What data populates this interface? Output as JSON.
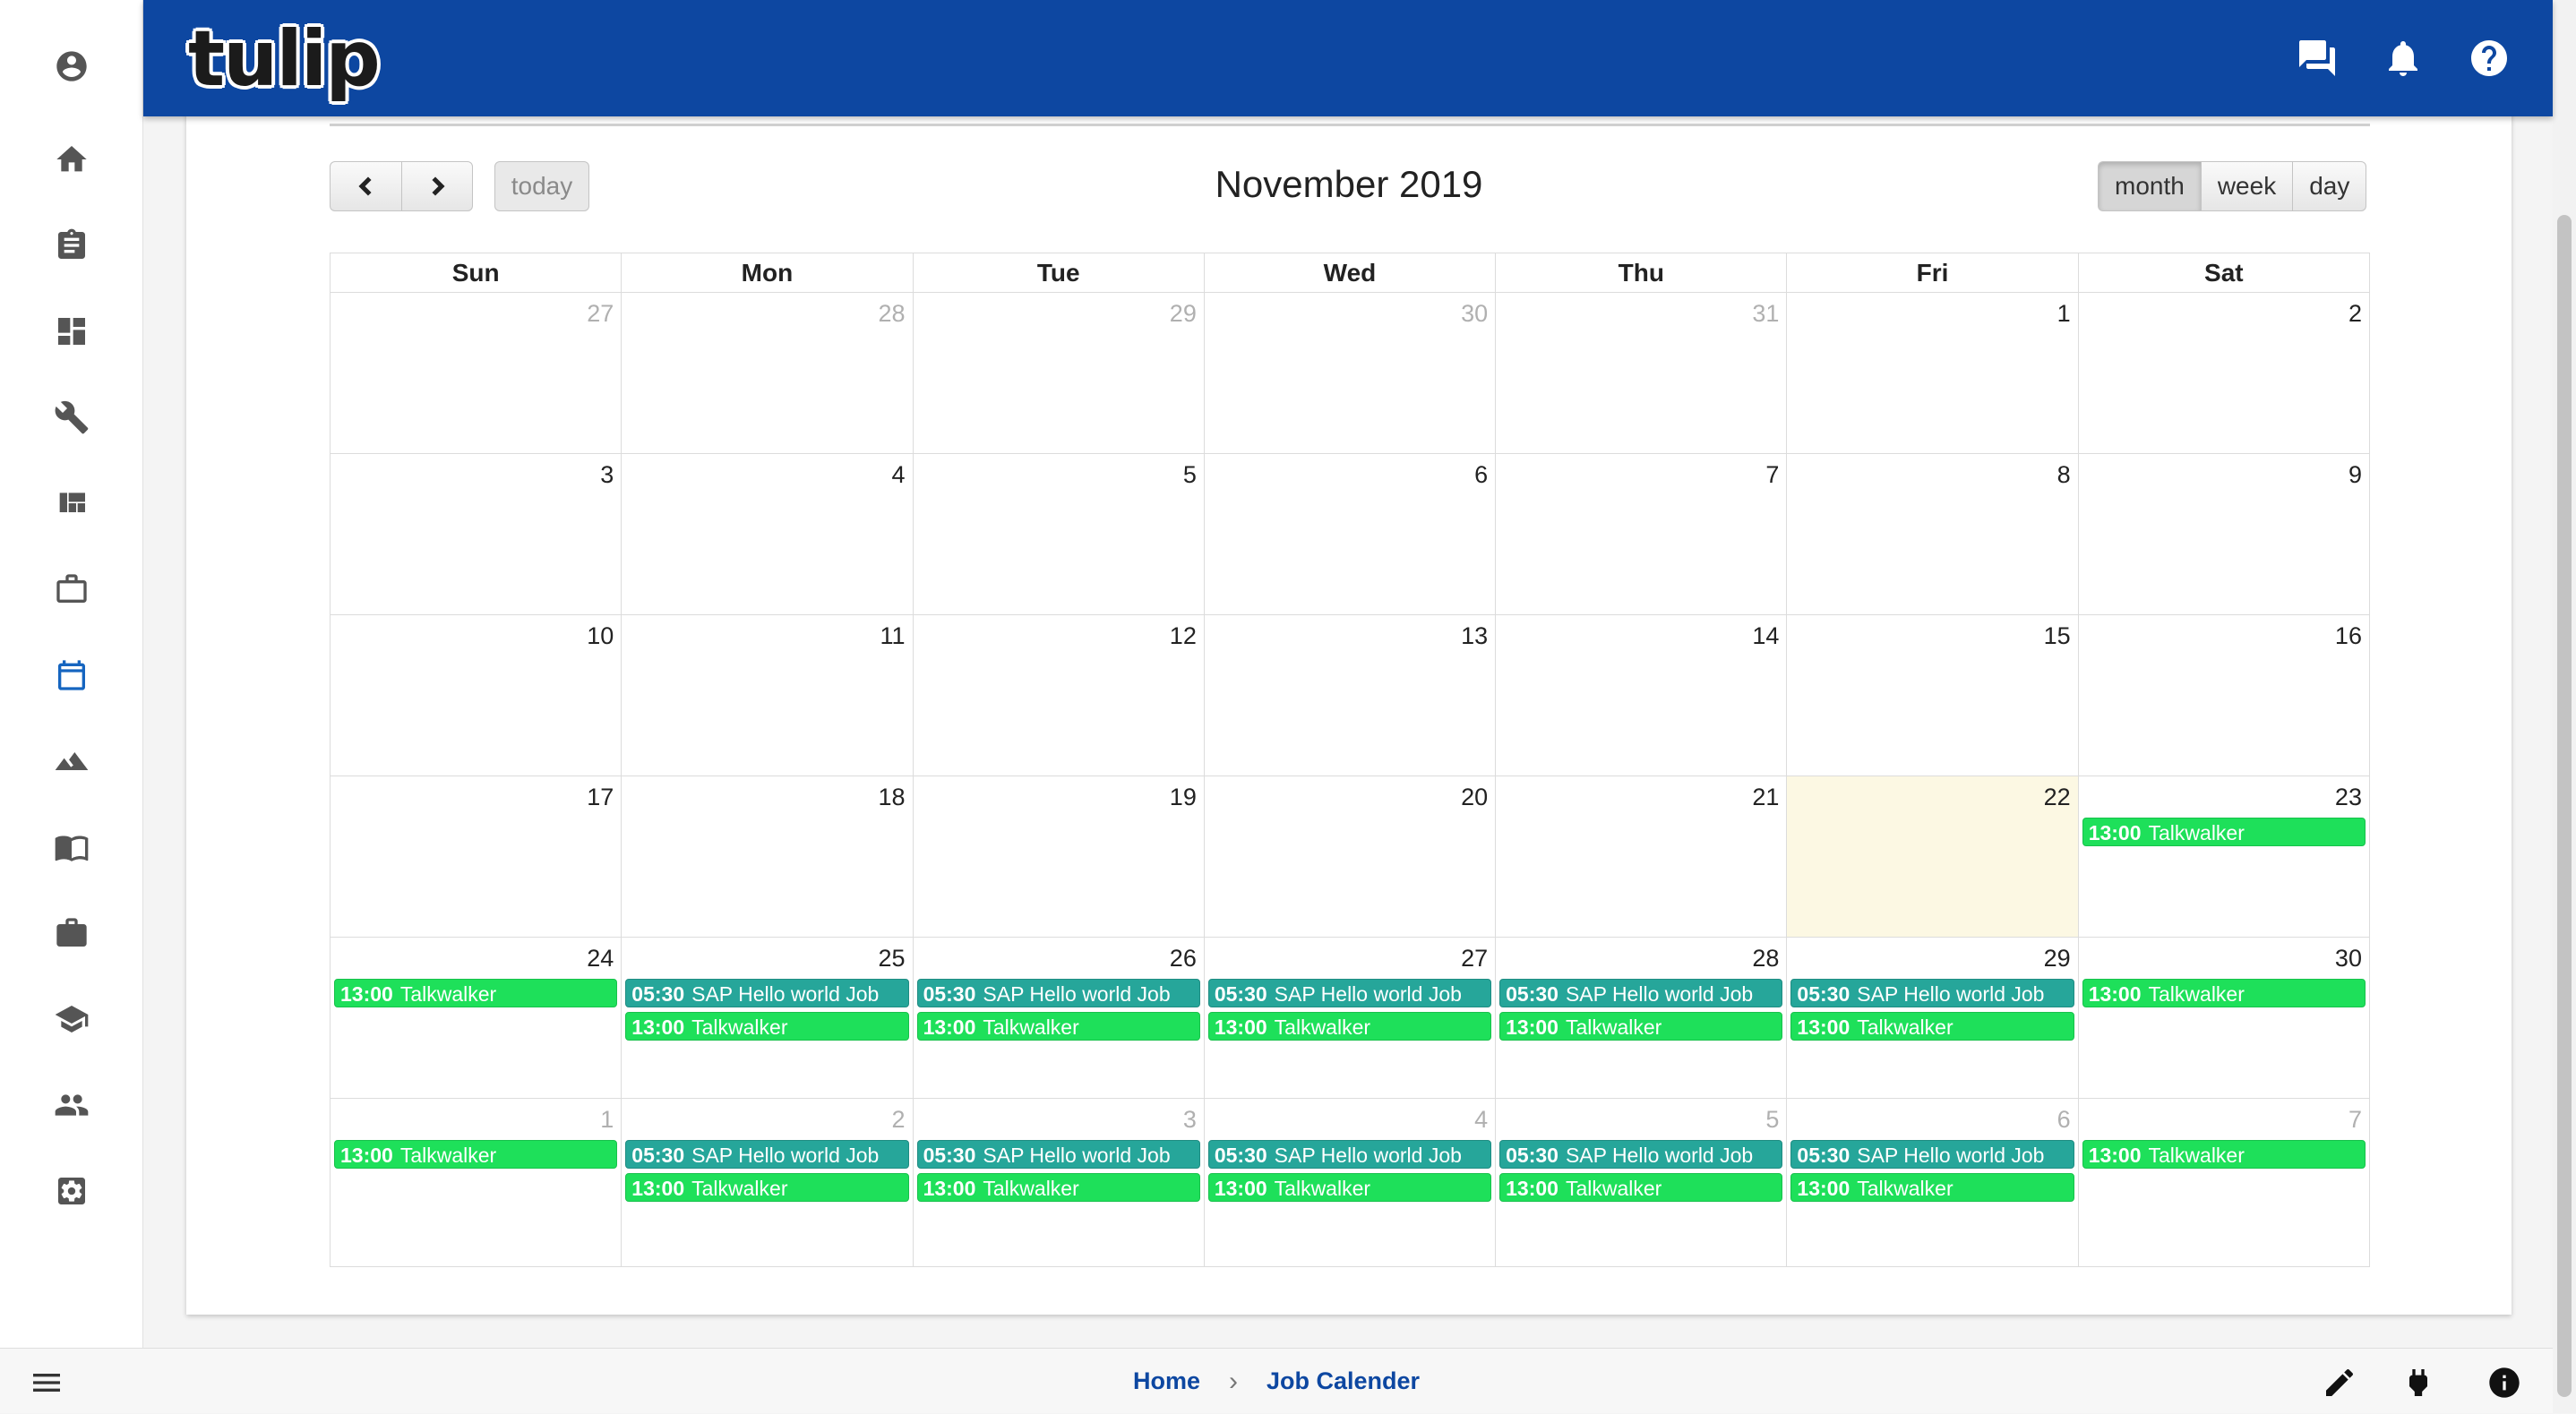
{
  "app": {
    "logo_text": "tulip"
  },
  "sidebar": {
    "items": [
      {
        "icon": "account-icon"
      },
      {
        "icon": "home-icon"
      },
      {
        "icon": "clipboard-icon"
      },
      {
        "icon": "dashboard-icon"
      },
      {
        "icon": "wrench-icon"
      },
      {
        "icon": "quilt-icon"
      },
      {
        "icon": "work-outline-icon"
      },
      {
        "icon": "calendar-icon",
        "active": true
      },
      {
        "icon": "landscape-icon"
      },
      {
        "icon": "book-icon"
      },
      {
        "icon": "briefcase-icon"
      },
      {
        "icon": "school-icon"
      },
      {
        "icon": "people-icon"
      },
      {
        "icon": "settings-icon"
      }
    ]
  },
  "topbar": {
    "icons": [
      "chat-icon",
      "bell-icon",
      "help-icon"
    ]
  },
  "calendar": {
    "title": "November 2019",
    "today_label": "today",
    "views": [
      {
        "label": "month",
        "active": true
      },
      {
        "label": "week",
        "active": false
      },
      {
        "label": "day",
        "active": false
      }
    ],
    "weekdays": [
      "Sun",
      "Mon",
      "Tue",
      "Wed",
      "Thu",
      "Fri",
      "Sat"
    ],
    "weeks": [
      [
        {
          "day": "27",
          "other": true,
          "events": []
        },
        {
          "day": "28",
          "other": true,
          "events": []
        },
        {
          "day": "29",
          "other": true,
          "events": []
        },
        {
          "day": "30",
          "other": true,
          "events": []
        },
        {
          "day": "31",
          "other": true,
          "events": []
        },
        {
          "day": "1",
          "events": []
        },
        {
          "day": "2",
          "events": []
        }
      ],
      [
        {
          "day": "3",
          "events": []
        },
        {
          "day": "4",
          "events": []
        },
        {
          "day": "5",
          "events": []
        },
        {
          "day": "6",
          "events": []
        },
        {
          "day": "7",
          "events": []
        },
        {
          "day": "8",
          "events": []
        },
        {
          "day": "9",
          "events": []
        }
      ],
      [
        {
          "day": "10",
          "events": []
        },
        {
          "day": "11",
          "events": []
        },
        {
          "day": "12",
          "events": []
        },
        {
          "day": "13",
          "events": []
        },
        {
          "day": "14",
          "events": []
        },
        {
          "day": "15",
          "events": []
        },
        {
          "day": "16",
          "events": []
        }
      ],
      [
        {
          "day": "17",
          "events": []
        },
        {
          "day": "18",
          "events": []
        },
        {
          "day": "19",
          "events": []
        },
        {
          "day": "20",
          "events": []
        },
        {
          "day": "21",
          "events": []
        },
        {
          "day": "22",
          "today": true,
          "events": []
        },
        {
          "day": "23",
          "events": [
            {
              "time": "13:00",
              "title": "Talkwalker",
              "kind": "talk"
            }
          ]
        }
      ],
      [
        {
          "day": "24",
          "events": [
            {
              "time": "13:00",
              "title": "Talkwalker",
              "kind": "talk"
            }
          ]
        },
        {
          "day": "25",
          "events": [
            {
              "time": "05:30",
              "title": "SAP Hello world Job",
              "kind": "sap"
            },
            {
              "time": "13:00",
              "title": "Talkwalker",
              "kind": "talk"
            }
          ]
        },
        {
          "day": "26",
          "events": [
            {
              "time": "05:30",
              "title": "SAP Hello world Job",
              "kind": "sap"
            },
            {
              "time": "13:00",
              "title": "Talkwalker",
              "kind": "talk"
            }
          ]
        },
        {
          "day": "27",
          "events": [
            {
              "time": "05:30",
              "title": "SAP Hello world Job",
              "kind": "sap"
            },
            {
              "time": "13:00",
              "title": "Talkwalker",
              "kind": "talk"
            }
          ]
        },
        {
          "day": "28",
          "events": [
            {
              "time": "05:30",
              "title": "SAP Hello world Job",
              "kind": "sap"
            },
            {
              "time": "13:00",
              "title": "Talkwalker",
              "kind": "talk"
            }
          ]
        },
        {
          "day": "29",
          "events": [
            {
              "time": "05:30",
              "title": "SAP Hello world Job",
              "kind": "sap"
            },
            {
              "time": "13:00",
              "title": "Talkwalker",
              "kind": "talk"
            }
          ]
        },
        {
          "day": "30",
          "events": [
            {
              "time": "13:00",
              "title": "Talkwalker",
              "kind": "talk"
            }
          ]
        }
      ],
      [
        {
          "day": "1",
          "other": true,
          "events": [
            {
              "time": "13:00",
              "title": "Talkwalker",
              "kind": "talk"
            }
          ]
        },
        {
          "day": "2",
          "other": true,
          "events": [
            {
              "time": "05:30",
              "title": "SAP Hello world Job",
              "kind": "sap"
            },
            {
              "time": "13:00",
              "title": "Talkwalker",
              "kind": "talk"
            }
          ]
        },
        {
          "day": "3",
          "other": true,
          "events": [
            {
              "time": "05:30",
              "title": "SAP Hello world Job",
              "kind": "sap"
            },
            {
              "time": "13:00",
              "title": "Talkwalker",
              "kind": "talk"
            }
          ]
        },
        {
          "day": "4",
          "other": true,
          "events": [
            {
              "time": "05:30",
              "title": "SAP Hello world Job",
              "kind": "sap"
            },
            {
              "time": "13:00",
              "title": "Talkwalker",
              "kind": "talk"
            }
          ]
        },
        {
          "day": "5",
          "other": true,
          "events": [
            {
              "time": "05:30",
              "title": "SAP Hello world Job",
              "kind": "sap"
            },
            {
              "time": "13:00",
              "title": "Talkwalker",
              "kind": "talk"
            }
          ]
        },
        {
          "day": "6",
          "other": true,
          "events": [
            {
              "time": "05:30",
              "title": "SAP Hello world Job",
              "kind": "sap"
            },
            {
              "time": "13:00",
              "title": "Talkwalker",
              "kind": "talk"
            }
          ]
        },
        {
          "day": "7",
          "other": true,
          "events": [
            {
              "time": "13:00",
              "title": "Talkwalker",
              "kind": "talk"
            }
          ]
        }
      ]
    ]
  },
  "footer": {
    "breadcrumb": [
      "Home",
      "Job Calender"
    ],
    "icons": [
      "menu-icon",
      "pencil-icon",
      "plug-icon",
      "info-icon"
    ]
  },
  "colors": {
    "topbar": "#0d47a1",
    "event_sap": "#26a69a",
    "event_talk": "#1ee05a",
    "today_bg": "#fcf8e3",
    "active_nav": "#1565c0"
  }
}
